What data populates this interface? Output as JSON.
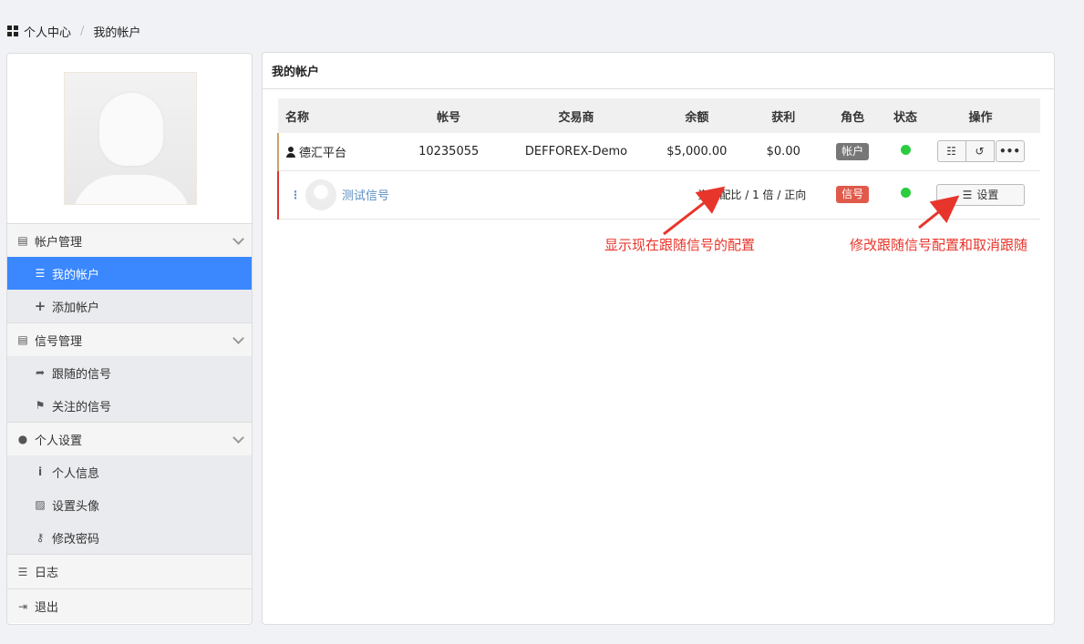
{
  "breadcrumb": {
    "home": "个人中心",
    "current": "我的帐户"
  },
  "sidebar": {
    "groups": [
      {
        "label": "帐户管理",
        "items": [
          "我的帐户",
          "添加帐户"
        ]
      },
      {
        "label": "信号管理",
        "items": [
          "跟随的信号",
          "关注的信号"
        ]
      },
      {
        "label": "个人设置",
        "items": [
          "个人信息",
          "设置头像",
          "修改密码"
        ]
      }
    ],
    "log": "日志",
    "logout": "退出"
  },
  "panel": {
    "title": "我的帐户"
  },
  "table": {
    "headers": [
      "名称",
      "帐号",
      "交易商",
      "余额",
      "获利",
      "角色",
      "状态",
      "操作"
    ],
    "row1": {
      "name": "德汇平台",
      "account": "10235055",
      "broker": "DEFFOREX-Demo",
      "balance": "$5,000.00",
      "profit": "$0.00",
      "role": "帐户"
    },
    "row2": {
      "name": "测试信号",
      "config": "资金配比 / 1 倍 / 正向",
      "role": "信号",
      "button": "设置"
    }
  },
  "annotations": {
    "a1": "显示现在跟随信号的配置",
    "a2": "修改跟随信号配置和取消跟随"
  },
  "colors": {
    "active": "#3a87fe",
    "status_ok": "#2bcc3f",
    "signal_badge": "#e05a4b",
    "annotation": "#e8352b"
  }
}
